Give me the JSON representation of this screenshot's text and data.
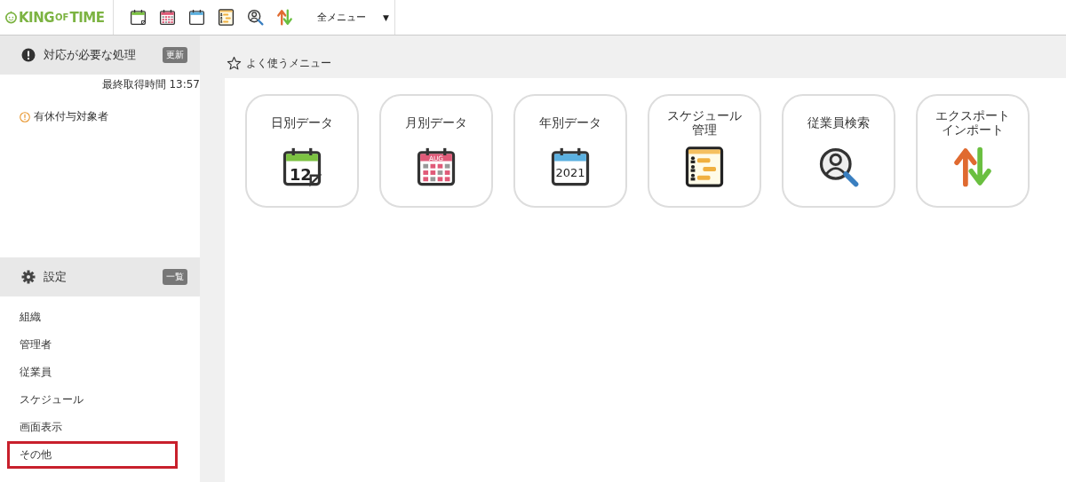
{
  "header": {
    "logo": [
      "KING",
      "OF",
      "TIME"
    ],
    "toolbar": [
      {
        "kind": "daily"
      },
      {
        "kind": "monthly"
      },
      {
        "kind": "yearly"
      },
      {
        "kind": "schedule"
      },
      {
        "kind": "search"
      },
      {
        "kind": "transfer"
      }
    ],
    "menu": {
      "label": "全メニュー",
      "caret": "▼"
    }
  },
  "sidebar": {
    "alerts": {
      "title": "対応が必要な処理",
      "button": "更新",
      "last_updated": "最終取得時間 13:57",
      "items": [
        {
          "label": "有休付与対象者"
        }
      ]
    },
    "settings": {
      "title": "設定",
      "button": "一覧",
      "items": [
        {
          "label": "組織",
          "highlighted": false
        },
        {
          "label": "管理者",
          "highlighted": false
        },
        {
          "label": "従業員",
          "highlighted": false
        },
        {
          "label": "スケジュール",
          "highlighted": false
        },
        {
          "label": "画面表示",
          "highlighted": false
        },
        {
          "label": "その他",
          "highlighted": true
        }
      ]
    }
  },
  "main": {
    "title": "よく使うメニュー",
    "tiles": [
      {
        "kind": "daily",
        "label": "日別データ",
        "icon_text": "12"
      },
      {
        "kind": "monthly",
        "label": "月別データ",
        "icon_text": "AUG"
      },
      {
        "kind": "yearly",
        "label": "年別データ",
        "icon_text": "2021"
      },
      {
        "kind": "schedule",
        "label": "スケジュール",
        "label_2": "管理"
      },
      {
        "kind": "search",
        "label": "従業員検索"
      },
      {
        "kind": "transfer",
        "label": "エクスポート",
        "label_2": "インポート"
      }
    ]
  }
}
